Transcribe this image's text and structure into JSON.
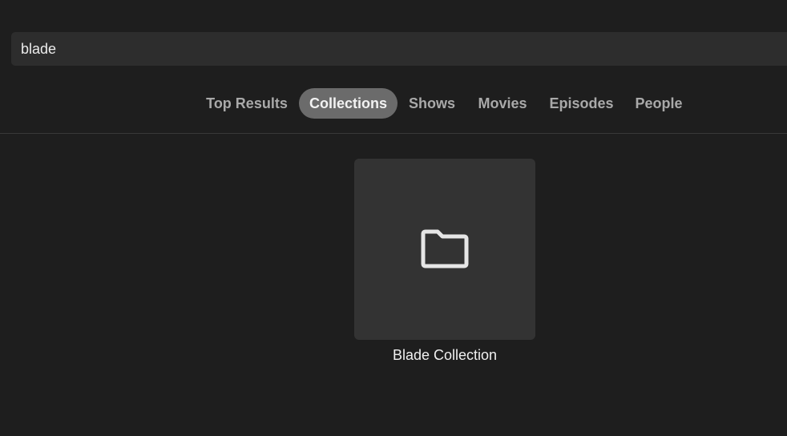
{
  "search": {
    "value": "blade",
    "placeholder": ""
  },
  "tabs": [
    {
      "label": "Top Results",
      "active": false
    },
    {
      "label": "Collections",
      "active": true
    },
    {
      "label": "Shows",
      "active": false
    },
    {
      "label": "Movies",
      "active": false
    },
    {
      "label": "Episodes",
      "active": false
    },
    {
      "label": "People",
      "active": false
    }
  ],
  "results": [
    {
      "title": "Blade Collection",
      "icon": "folder-icon"
    }
  ],
  "colors": {
    "background": "#1e1e1e",
    "search_background": "#2d2d2d",
    "active_tab": "#6b6b6b",
    "card_background": "#333333"
  }
}
